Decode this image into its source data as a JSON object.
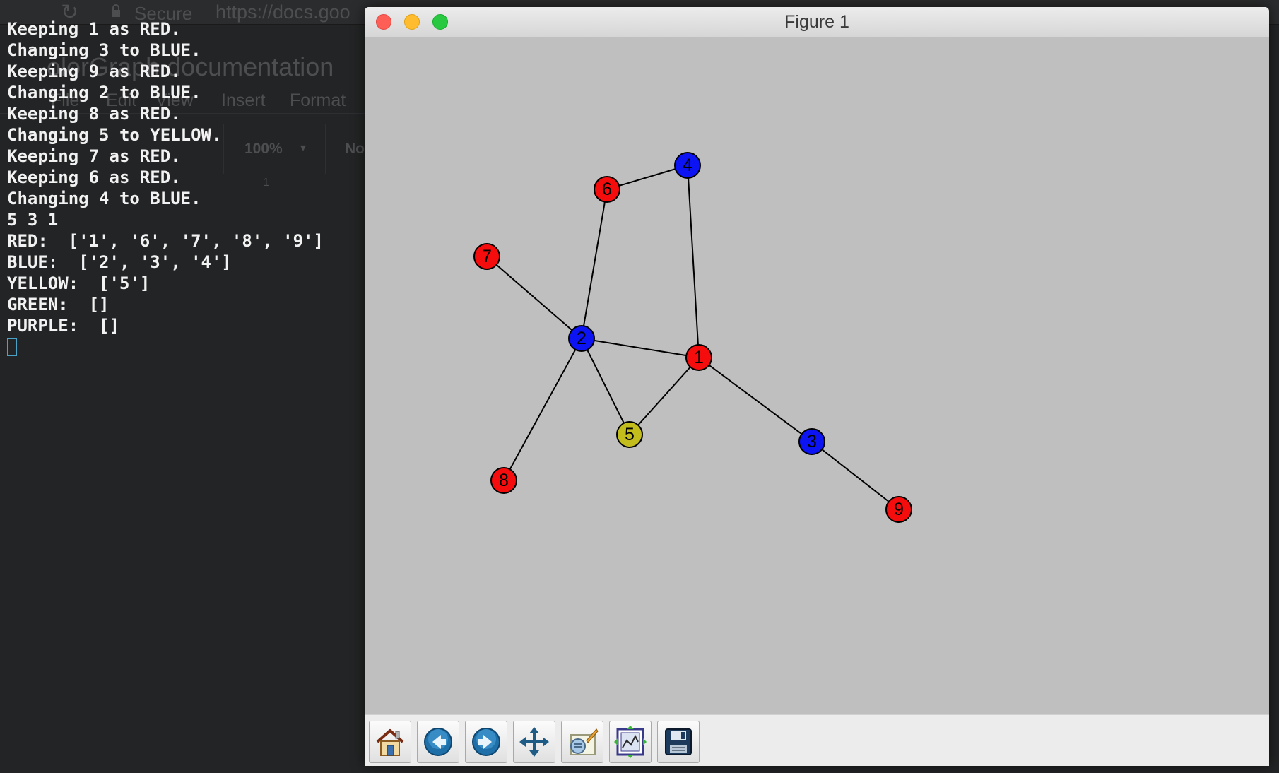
{
  "browser_background": {
    "secure_label": "Secure",
    "url": "https://docs.goo",
    "doc_title": "olorGraph documentation",
    "menu": [
      "File",
      "Edit",
      "View",
      "Insert",
      "Format"
    ],
    "zoom": "100%",
    "style": "No",
    "ruler_mark": "1"
  },
  "terminal": {
    "lines": [
      "Keeping 1 as RED.",
      "Changing 3 to BLUE.",
      "Keeping 9 as RED.",
      "Changing 2 to BLUE.",
      "Keeping 8 as RED.",
      "Changing 5 to YELLOW.",
      "Keeping 7 as RED.",
      "Keeping 6 as RED.",
      "Changing 4 to BLUE.",
      "5 3 1",
      "RED:  ['1', '6', '7', '8', '9']",
      "BLUE:  ['2', '3', '4']",
      "YELLOW:  ['5']",
      "GREEN:  []",
      "PURPLE:  []"
    ]
  },
  "figure": {
    "window_title": "Figure 1",
    "colors": {
      "RED": "#f50d0d",
      "BLUE": "#0c14f4",
      "YELLOW": "#c2bd1c",
      "background": "#bfbfbf"
    },
    "toolbar": [
      {
        "name": "home-icon",
        "label": "Home"
      },
      {
        "name": "back-arrow-icon",
        "label": "Back"
      },
      {
        "name": "forward-arrow-icon",
        "label": "Forward"
      },
      {
        "name": "pan-icon",
        "label": "Pan"
      },
      {
        "name": "zoom-rect-icon",
        "label": "Zoom"
      },
      {
        "name": "subplots-icon",
        "label": "Subplots"
      },
      {
        "name": "save-disk-icon",
        "label": "Save"
      }
    ]
  },
  "chart_data": {
    "type": "graph",
    "nodes": [
      {
        "id": "1",
        "color": "RED"
      },
      {
        "id": "2",
        "color": "BLUE"
      },
      {
        "id": "3",
        "color": "BLUE"
      },
      {
        "id": "4",
        "color": "BLUE"
      },
      {
        "id": "5",
        "color": "YELLOW"
      },
      {
        "id": "6",
        "color": "RED"
      },
      {
        "id": "7",
        "color": "RED"
      },
      {
        "id": "8",
        "color": "RED"
      },
      {
        "id": "9",
        "color": "RED"
      }
    ],
    "edges": [
      [
        "6",
        "4"
      ],
      [
        "4",
        "1"
      ],
      [
        "6",
        "2"
      ],
      [
        "7",
        "2"
      ],
      [
        "2",
        "1"
      ],
      [
        "2",
        "5"
      ],
      [
        "5",
        "1"
      ],
      [
        "2",
        "8"
      ],
      [
        "1",
        "3"
      ],
      [
        "3",
        "9"
      ]
    ]
  }
}
